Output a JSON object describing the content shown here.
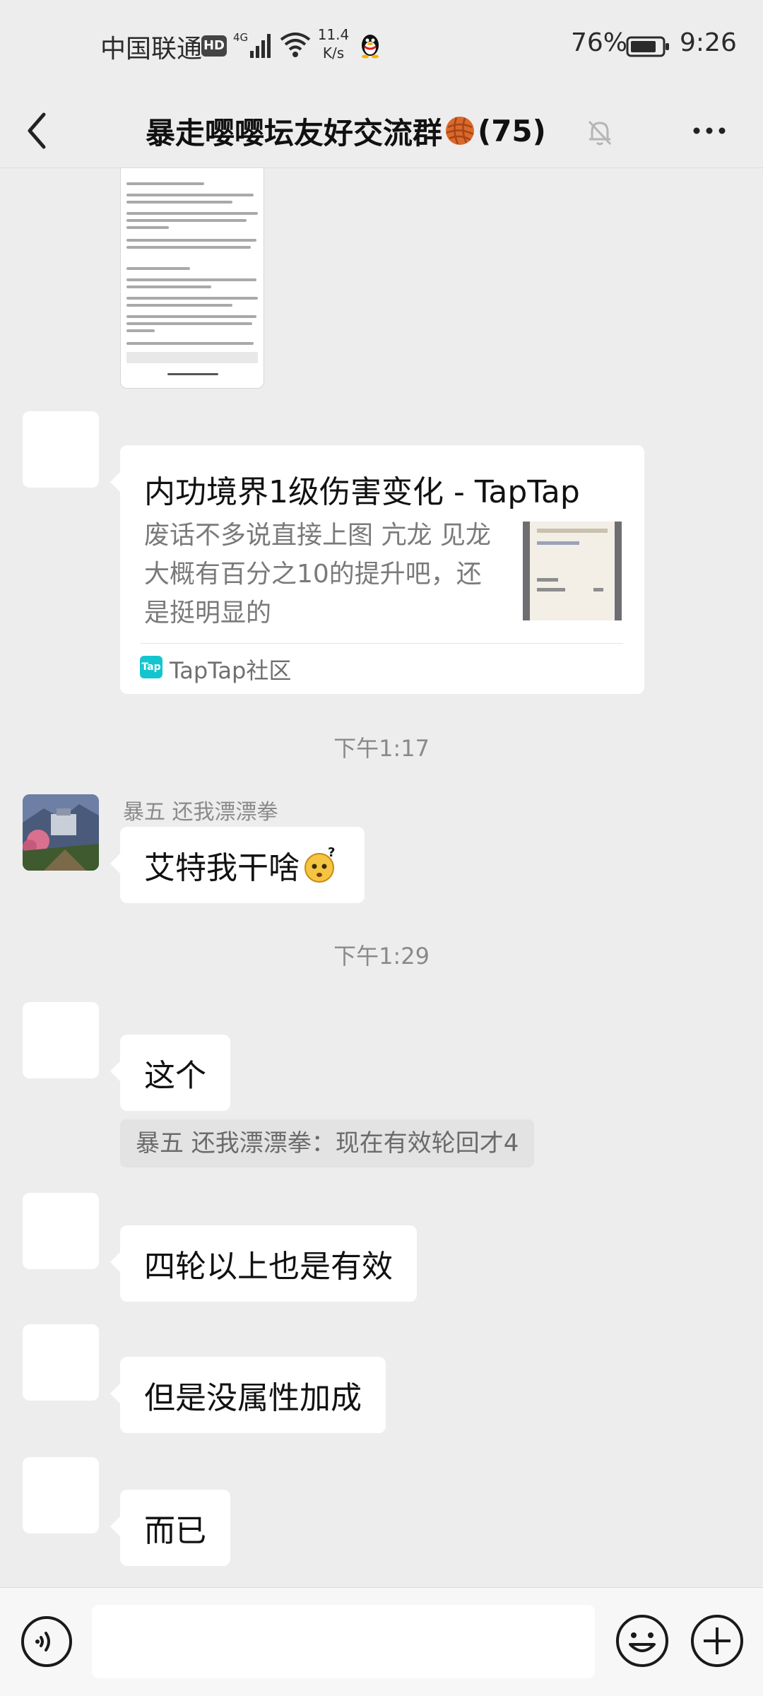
{
  "status_bar": {
    "carrier": "中国联通",
    "hd": "HD",
    "network": "4G",
    "speed_value": "11.4",
    "speed_unit": "K/s",
    "battery": "76%",
    "time": "9:26"
  },
  "header": {
    "title": "暴走嘤嘤坛友好交流群",
    "member_count": "(75)",
    "icons": [
      "back-icon",
      "yarn-ball-icon",
      "mute-bell-icon",
      "more-icon"
    ]
  },
  "messages": {
    "link_card": {
      "title": "内功境界1级伤害变化 - TapTap",
      "desc": "废话不多说直接上图 亢龙 见龙 大概有百分之10的提升吧，还是挺明显的",
      "source": "TapTap社区",
      "source_icon": "Tap"
    },
    "time1": "下午1:17",
    "nick1": "暴五 还我漂漂拳",
    "msg1": "艾特我干啥",
    "time2": "下午1:29",
    "msg2": "这个",
    "quote": "暴五 还我漂漂拳：现在有效轮回才4",
    "msg3": "四轮以上也是有效",
    "msg4": "但是没属性加成",
    "msg5": "而已"
  },
  "input_bar": {
    "icons": [
      "voice-icon",
      "emoji-icon",
      "plus-icon"
    ]
  },
  "colors": {
    "background": "#ededed",
    "bubble": "#ffffff",
    "tap_brand": "#15c5ce"
  }
}
